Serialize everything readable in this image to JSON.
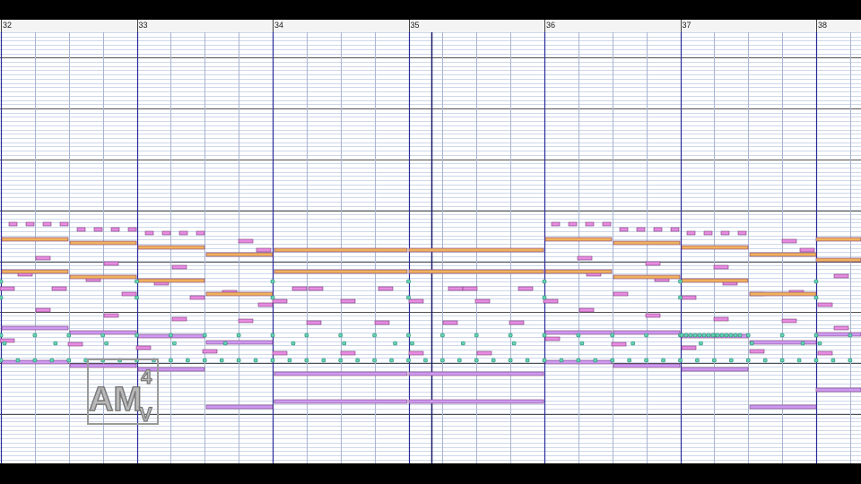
{
  "ruler": {
    "measures": [
      "32",
      "33",
      "34",
      "35",
      "36",
      "37",
      "38"
    ]
  },
  "colors": {
    "background": "#000000",
    "roll_background": "#ffffff",
    "pitch_line": "#cdd8ea",
    "octave_line": "#505050",
    "beat_line": "#a9b4d0",
    "measure_line": "#2a2a9a",
    "playhead": "#1a1a6a",
    "note_pink": "#e78ce0",
    "note_orange": "#f0b15e",
    "note_purple": "#cc9af0",
    "note_cyan": "#63d3b5"
  },
  "watermark": {
    "text": "AM",
    "sup": "4",
    "sub": "V"
  },
  "icons": [
    "watermark-logo"
  ]
}
